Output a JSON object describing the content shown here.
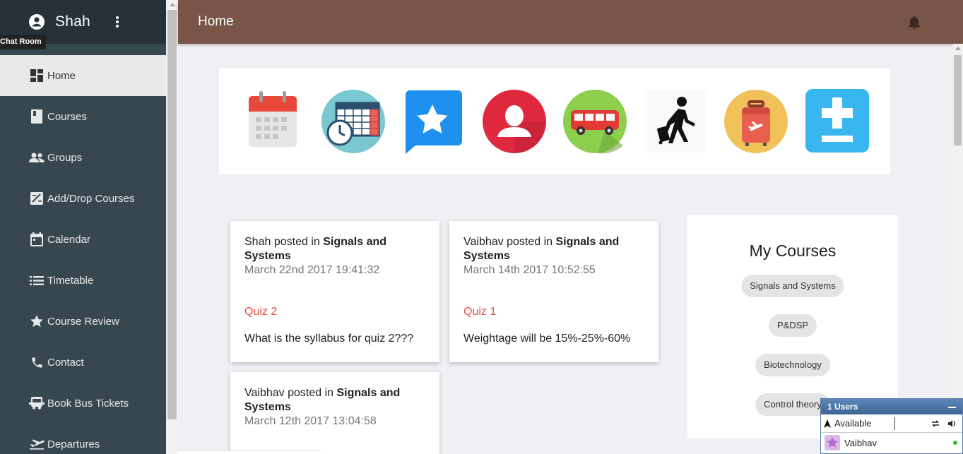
{
  "user": {
    "name": "Shah",
    "tooltip": "Chat Room"
  },
  "topbar": {
    "title": "Home"
  },
  "sidebar": {
    "items": [
      {
        "label": "Home",
        "icon": "dashboard-icon",
        "active": true
      },
      {
        "label": "Courses",
        "icon": "book-icon"
      },
      {
        "label": "Groups",
        "icon": "group-icon"
      },
      {
        "label": "Add/Drop Courses",
        "icon": "edit-box-icon"
      },
      {
        "label": "Calendar",
        "icon": "calendar-icon"
      },
      {
        "label": "Timetable",
        "icon": "list-icon"
      },
      {
        "label": "Course Review",
        "icon": "star-icon"
      },
      {
        "label": "Contact",
        "icon": "phone-icon"
      },
      {
        "label": "Book Bus Tickets",
        "icon": "bus-icon"
      },
      {
        "label": "Departures",
        "icon": "flight-icon"
      }
    ]
  },
  "quicklinks": [
    {
      "icon": "calendar-app-icon"
    },
    {
      "icon": "timetable-clock-icon"
    },
    {
      "icon": "review-star-icon"
    },
    {
      "icon": "contact-person-icon"
    },
    {
      "icon": "bus-app-icon"
    },
    {
      "icon": "traveler-icon"
    },
    {
      "icon": "luggage-icon"
    },
    {
      "icon": "add-course-icon"
    }
  ],
  "posts": [
    {
      "author": "Shah",
      "posted_in": "posted in",
      "course": "Signals and Systems",
      "date": "March 22nd 2017 19:41:32",
      "title": "Quiz 2",
      "body": "What is the syllabus for quiz 2???"
    },
    {
      "author": "Vaibhav",
      "posted_in": "posted in",
      "course": "Signals and Systems",
      "date": "March 14th 2017 10:52:55",
      "title": "Quiz 1",
      "body": "Weightage will be 15%-25%-60%"
    },
    {
      "author": "Vaibhav",
      "posted_in": "posted in",
      "course": "Signals and Systems",
      "date": "March 12th 2017 13:04:58"
    }
  ],
  "my_courses": {
    "title": "My Courses",
    "courses": [
      "Signals and Systems",
      "P&DSP",
      "Biotechnology",
      "Control theory"
    ]
  },
  "chat": {
    "header": "1 Users",
    "status": "Available",
    "users": [
      "Vaibhav"
    ]
  },
  "colors": {
    "topbar": "#795548",
    "sidebar": "#37474f",
    "accent_red": "#e34d43"
  }
}
